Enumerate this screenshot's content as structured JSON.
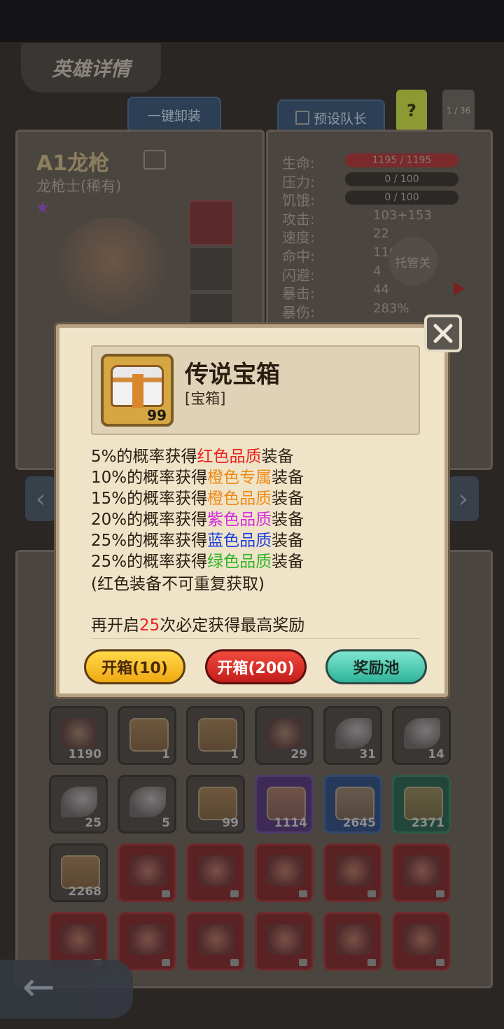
{
  "page": {
    "title": "英雄详情"
  },
  "top_buttons": {
    "unequip_all": "一键卸装",
    "preset_leader": "预设队长",
    "help": "?",
    "pager": "1 / 36"
  },
  "hero": {
    "name": "A1龙枪",
    "class": "龙枪士(稀有)"
  },
  "stats": [
    {
      "label": "生命:",
      "value": "1195 / 1195",
      "bar": true,
      "bar_color": "#7a2a2a"
    },
    {
      "label": "压力:",
      "value": "0 / 100",
      "bar": true,
      "bar_color": "#2b2825"
    },
    {
      "label": "饥饿:",
      "value": "0 / 100",
      "bar": true,
      "bar_color": "#2b2825"
    },
    {
      "label": "攻击:",
      "value": "103+153"
    },
    {
      "label": "速度:",
      "value": "22"
    },
    {
      "label": "命中:",
      "value": "116"
    },
    {
      "label": "闪避:",
      "value": "4"
    },
    {
      "label": "暴击:",
      "value": "44"
    },
    {
      "label": "暴伤:",
      "value": "283%"
    }
  ],
  "auto_btn": "托管关",
  "dialog": {
    "item_name": "传说宝箱",
    "item_type": "[宝箱]",
    "item_count": "99",
    "chances": [
      {
        "pre": "5%的概率获得",
        "hl": "红色品质",
        "post": "装备",
        "color": "#e8231f"
      },
      {
        "pre": "10%的概率获得",
        "hl": "橙色专属",
        "post": "装备",
        "color": "#f08a14"
      },
      {
        "pre": "15%的概率获得",
        "hl": "橙色品质",
        "post": "装备",
        "color": "#f08a14"
      },
      {
        "pre": "20%的概率获得",
        "hl": "紫色品质",
        "post": "装备",
        "color": "#d62bdc"
      },
      {
        "pre": "25%的概率获得",
        "hl": "蓝色品质",
        "post": "装备",
        "color": "#1c3fe0"
      },
      {
        "pre": "25%的概率获得",
        "hl": "绿色品质",
        "post": "装备",
        "color": "#2fb525"
      }
    ],
    "note": "(红色装备不可重复获取)",
    "guarantee": {
      "pre": "再开启",
      "num": "25",
      "post": "次必定获得最高奖励",
      "num_color": "#e8231f"
    },
    "buttons": {
      "open10": "开箱(10)",
      "open200": "开箱(200)",
      "pool": "奖励池"
    }
  },
  "inventory": [
    [
      {
        "c": "1190",
        "t": "potion"
      },
      {
        "c": "1",
        "t": "chest"
      },
      {
        "c": "1",
        "t": "chest"
      },
      {
        "c": "29",
        "t": "skull"
      },
      {
        "c": "31",
        "t": "leaf"
      },
      {
        "c": "14",
        "t": "leaf"
      }
    ],
    [
      {
        "c": "25",
        "t": "leaf"
      },
      {
        "c": "5",
        "t": "leaf"
      },
      {
        "c": "99",
        "t": "chest"
      },
      {
        "c": "1114",
        "t": "chest",
        "bg": "purple"
      },
      {
        "c": "2645",
        "t": "chest",
        "bg": "blue"
      },
      {
        "c": "2371",
        "t": "chest",
        "bg": "green"
      }
    ],
    [
      {
        "c": "2268",
        "t": "chest"
      },
      {
        "c": "",
        "t": "fan",
        "bg": "red"
      },
      {
        "c": "",
        "t": "book",
        "bg": "red"
      },
      {
        "c": "",
        "t": "gun",
        "bg": "red"
      },
      {
        "c": "",
        "t": "orb",
        "bg": "red"
      },
      {
        "c": "",
        "t": "drill",
        "bg": "red"
      }
    ],
    [
      {
        "c": "",
        "t": "blade",
        "bg": "red"
      },
      {
        "c": "",
        "t": "globe",
        "bg": "red"
      },
      {
        "c": "",
        "t": "sword",
        "bg": "red"
      },
      {
        "c": "",
        "t": "shield",
        "bg": "red"
      },
      {
        "c": "",
        "t": "leafblade",
        "bg": "red"
      },
      {
        "c": "",
        "t": "horn",
        "bg": "red"
      }
    ]
  ]
}
